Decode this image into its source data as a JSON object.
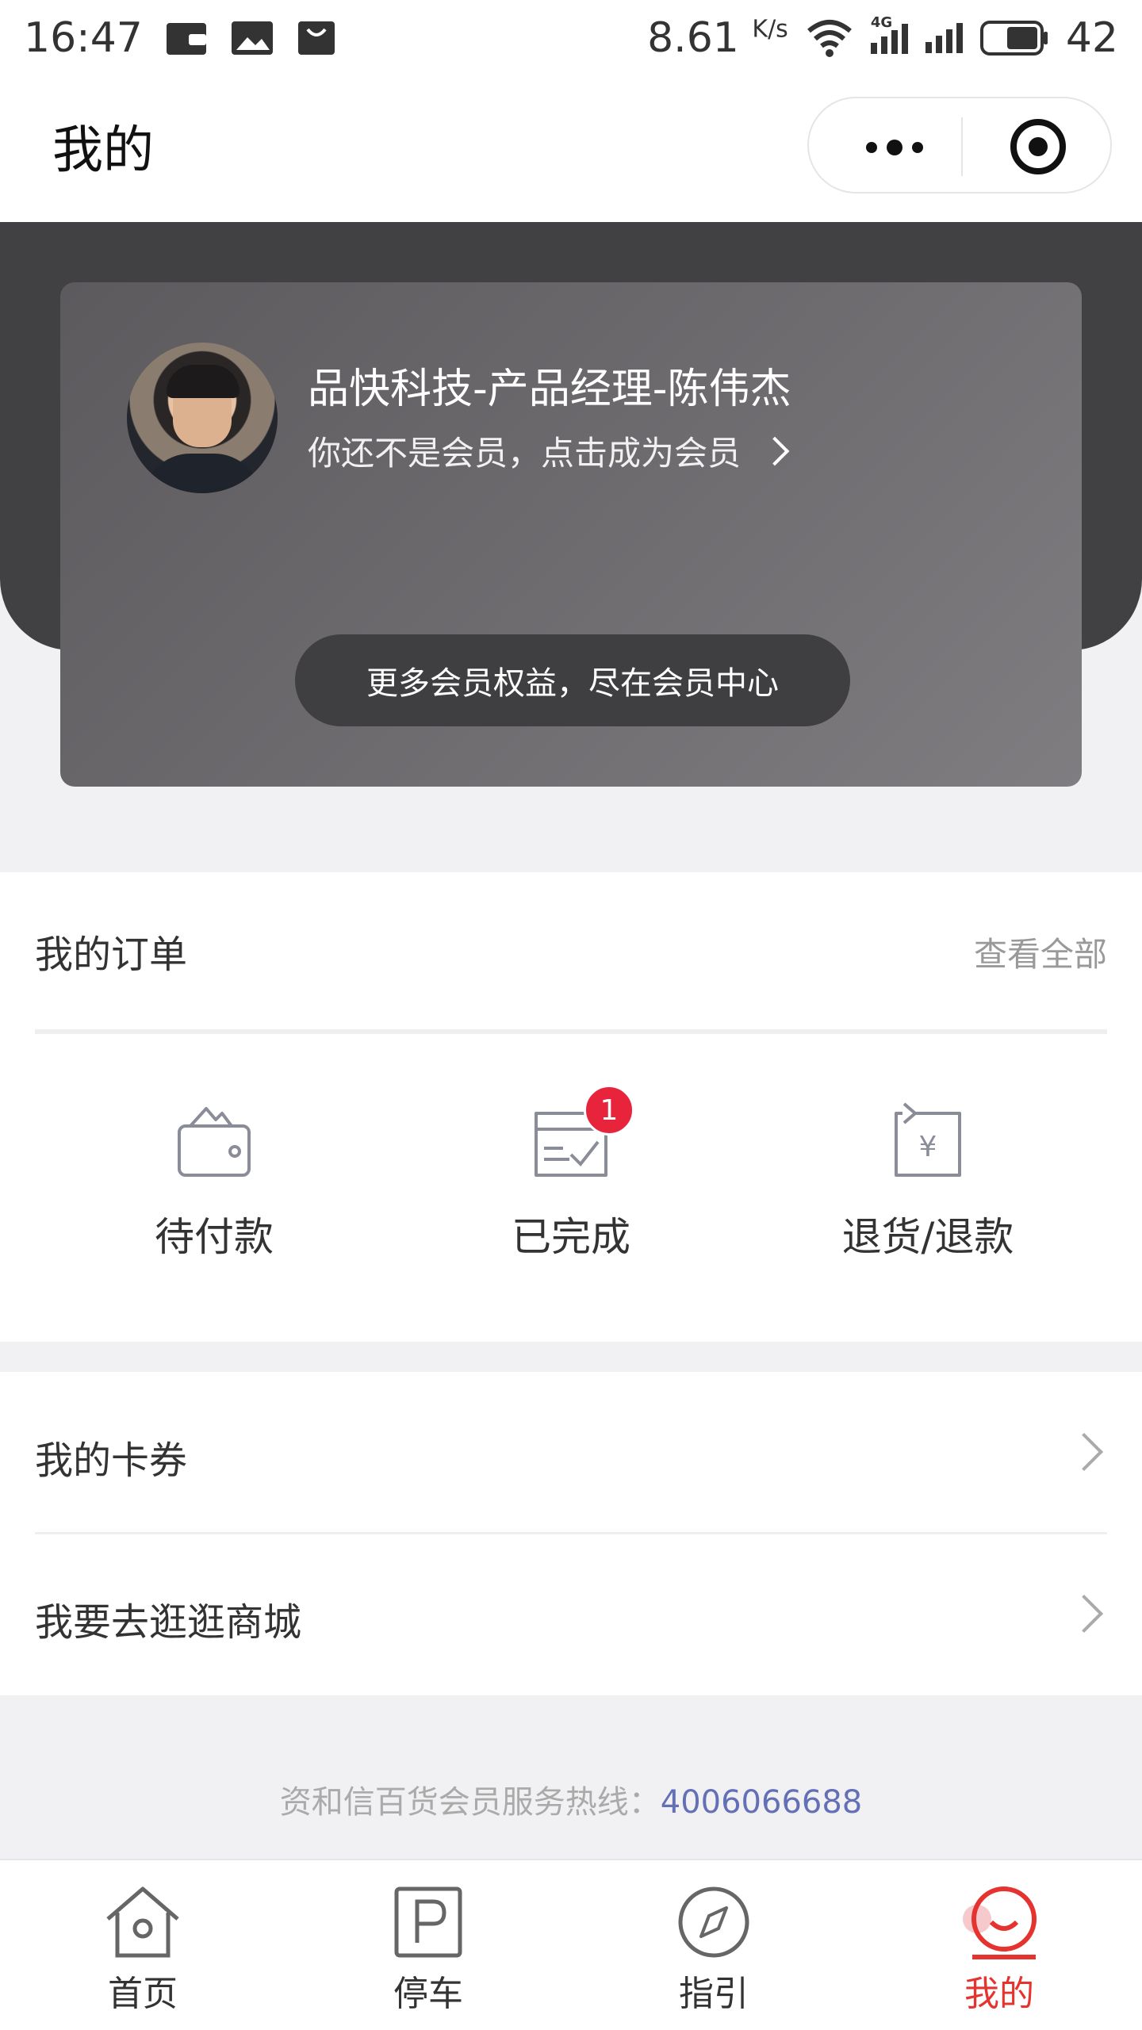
{
  "status_bar": {
    "time": "16:47",
    "speed_value": "8.61",
    "speed_unit": "K/s",
    "network": "4G",
    "battery": "42"
  },
  "nav": {
    "title": "我的"
  },
  "profile": {
    "name": "品快科技-产品经理-陈伟杰",
    "membership_prompt": "你还不是会员，点击成为会员",
    "member_center_button": "更多会员权益，尽在会员中心"
  },
  "orders": {
    "title": "我的订单",
    "view_all": "查看全部",
    "items": [
      {
        "label": "待付款",
        "icon": "wallet-icon"
      },
      {
        "label": "已完成",
        "icon": "completed-order-icon",
        "badge": "1"
      },
      {
        "label": "退货/退款",
        "icon": "refund-icon"
      }
    ]
  },
  "menu": {
    "items": [
      {
        "label": "我的卡券"
      },
      {
        "label": "我要去逛逛商城"
      }
    ]
  },
  "footer": {
    "hotline_label": "资和信百货会员服务热线：",
    "hotline_number": "4006066688"
  },
  "tabs": [
    {
      "label": "首页",
      "icon": "home-icon"
    },
    {
      "label": "停车",
      "icon": "parking-icon"
    },
    {
      "label": "指引",
      "icon": "compass-icon"
    },
    {
      "label": "我的",
      "icon": "profile-icon",
      "active": true
    }
  ],
  "colors": {
    "accent": "#e5332f",
    "badge": "#e8243c",
    "link": "#6470b6",
    "header_bg": "#414042"
  }
}
